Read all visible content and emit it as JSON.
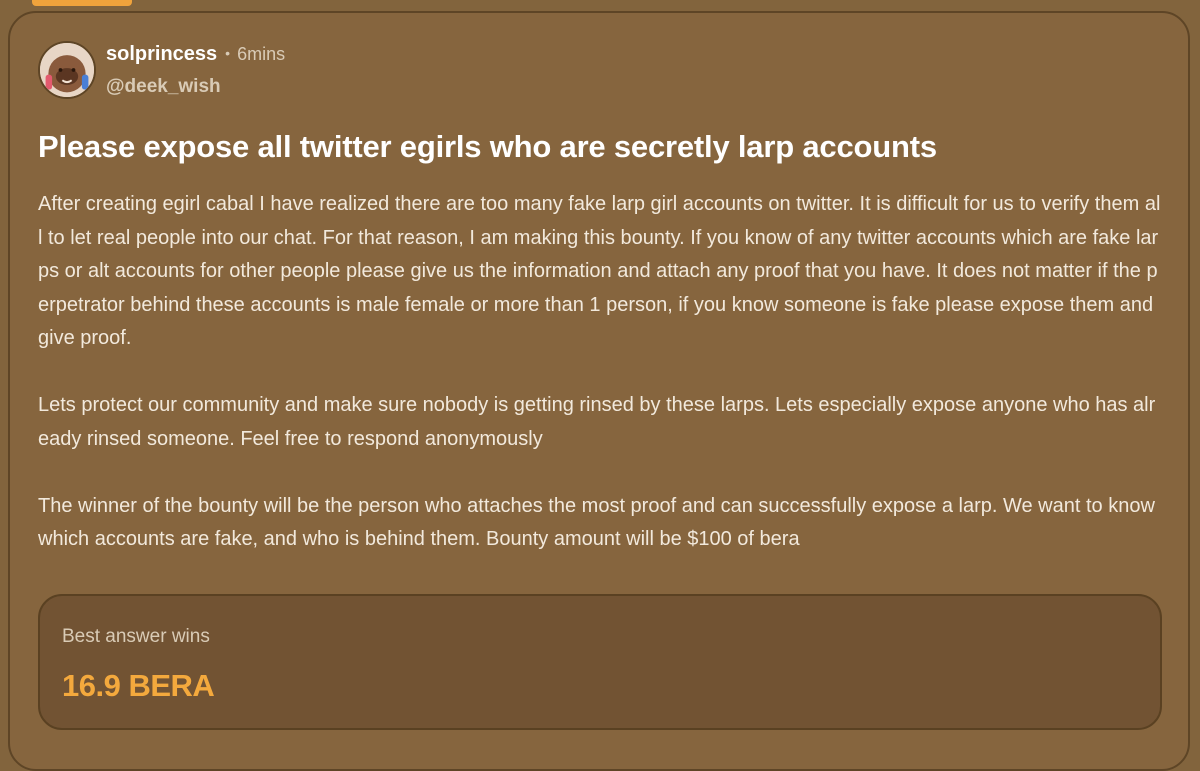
{
  "post": {
    "author": {
      "display_name": "solprincess",
      "separator": "•",
      "time": "6mins",
      "handle": "@deek_wish",
      "avatar_icon": "avatar-icon"
    },
    "title": "Please expose all twitter egirls who are secretly larp accounts",
    "paragraphs": [
      "After creating egirl cabal I have realized there are too many fake larp girl accounts on twitter. It is difficult for us to verify them all to let real people into our chat. For that reason, I am making this bounty. If you know of any twitter accounts which are fake larps or alt accounts for other people please give us the information and attach any proof that you have. It does not matter if the perpetrator behind these accounts is male female or more than 1 person, if you know someone is fake please expose them and give proof.",
      "Lets protect our community and make sure nobody is getting rinsed by these larps. Lets especially expose anyone who has already rinsed someone. Feel free to respond anonymously",
      "The winner of the bounty will be the person who attaches the most proof and can successfully expose a larp. We want to know which accounts are fake, and who is behind them. Bounty amount will be $100 of bera"
    ],
    "reward": {
      "label": "Best answer wins",
      "amount": "16.9 BERA"
    }
  },
  "colors": {
    "background": "#82643d",
    "accent": "#f4a93d",
    "text": "#f2e9dc"
  }
}
